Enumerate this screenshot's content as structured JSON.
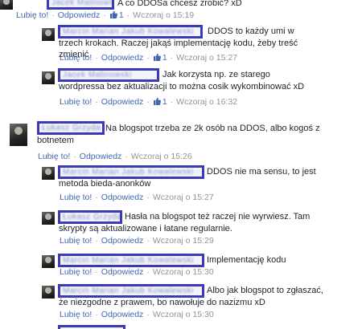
{
  "comments": [
    {
      "author": "Jacek Malinowski",
      "text": "A co DDOSa chcesz zrobić? xD",
      "actions": {
        "like": "Lubię to!",
        "reply": "Odpowiedz",
        "likes": "1",
        "time": "Wczoraj o 15:19"
      }
    },
    {
      "author": "Marcin Marian Jakub Kowalewski",
      "text": "DDOS to każdy umi w trzech krokach. Raczej jakąś implementację kodu, żeby treść zmienić",
      "actions": {
        "like": "Lubię to!",
        "reply": "Odpowiedz",
        "likes": "1",
        "time": "Wczoraj o 15:27"
      }
    },
    {
      "author": "Jacek Malinowski",
      "text": "Jak korzysta np. ze starego wordpressa bez aktualizacji to można cosik wykombinować xD",
      "actions": {
        "like": "Lubię to!",
        "reply": "Odpowiedz",
        "likes": "1",
        "time": "Wczoraj o 16:32"
      }
    },
    {
      "author": "Łukasz Grzyda",
      "text": "Na blogspot trzeba ze 2k osób na DDOS, albo kogoś z botnetem",
      "actions": {
        "like": "Lubię to!",
        "reply": "Odpowiedz",
        "time": "Wczoraj o 15:26"
      }
    },
    {
      "author": "Marcin Marian Jakub Kowalewski",
      "text": "DDOS nie ma sensu, to jest metoda bieda-anonków",
      "actions": {
        "like": "Lubię to!",
        "reply": "Odpowiedz",
        "time": "Wczoraj o 15:27"
      }
    },
    {
      "author": "Łukasz Grzyda",
      "text": "Hasła na blogspot też raczej nie wyrwiesz. Tam skrypty są aktualizowane i łatane regularnie.",
      "actions": {
        "like": "Lubię to!",
        "reply": "Odpowiedz",
        "time": "Wczoraj o 15:29"
      }
    },
    {
      "author": "Marcin Marian Jakub Kowalewski",
      "text": "Implementację kodu",
      "actions": {
        "like": "Lubię to!",
        "reply": "Odpowiedz",
        "time": "Wczoraj o 15:30"
      }
    },
    {
      "author": "Marcin Marian Jakub Kowalewski",
      "text": "Albo jak blogspot to zgłaszać, że niezgodne z prawem, bo nawołuje do nazizmu xD",
      "actions": {
        "like": "Lubię to!",
        "reply": "Odpowiedz",
        "time": "Wczoraj o 15:30"
      }
    }
  ],
  "colors": {
    "link": "#4267b2",
    "meta": "#90949c",
    "redaction_box": "#3b3bb8"
  }
}
